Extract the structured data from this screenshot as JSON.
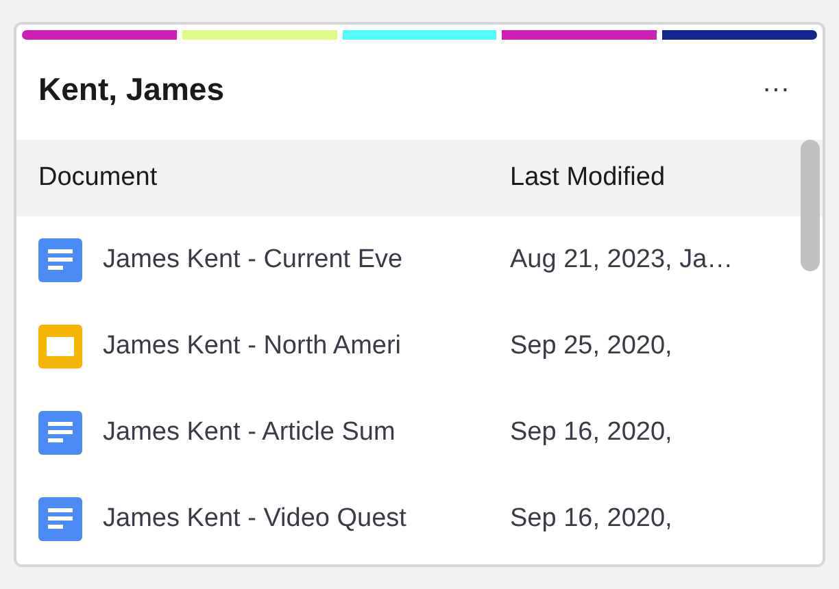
{
  "color_bar": [
    {
      "color": "#cc1fb4"
    },
    {
      "color": "#ddfa8a"
    },
    {
      "color": "#55fafa"
    },
    {
      "color": "#cc1fb4"
    },
    {
      "color": "#14258f"
    }
  ],
  "card": {
    "title": "Kent, James",
    "menu": "···"
  },
  "table": {
    "columns": [
      "Document",
      "Last Modified"
    ],
    "rows": [
      {
        "kind": "doc",
        "name": "James Kent - Current Eve",
        "modified": "Aug 21, 2023, Ja…"
      },
      {
        "kind": "slides",
        "name": "James Kent - North Ameri",
        "modified": "Sep 25, 2020,"
      },
      {
        "kind": "doc",
        "name": "James Kent - Article Sum",
        "modified": "Sep 16, 2020,"
      },
      {
        "kind": "doc",
        "name": "James Kent - Video Quest",
        "modified": "Sep 16, 2020,"
      }
    ]
  }
}
